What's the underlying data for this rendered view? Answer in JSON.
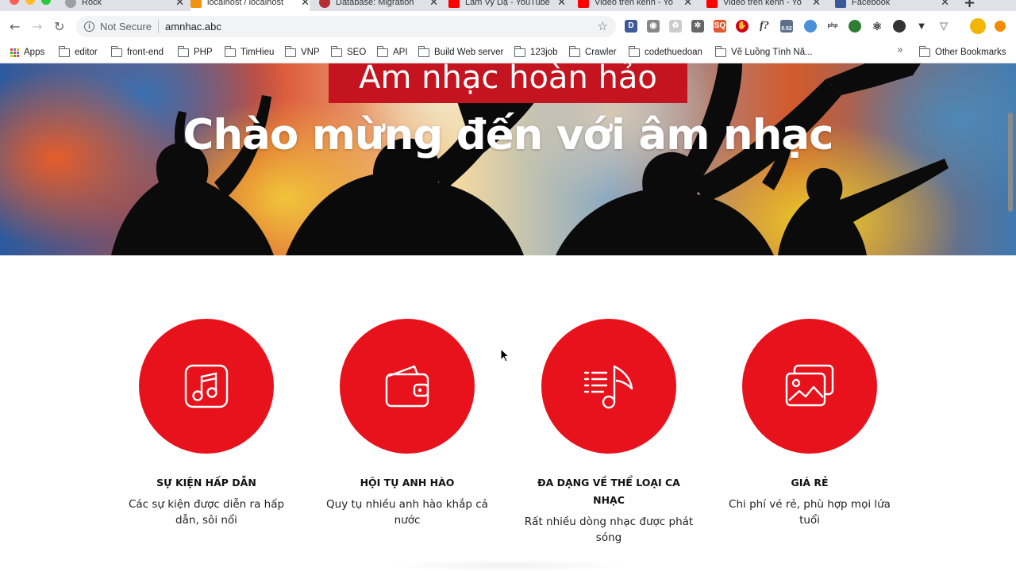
{
  "browser": {
    "tabs": [
      {
        "label": "Rock",
        "color": "#9aa0a6"
      },
      {
        "label": "localhost / localhost",
        "color": "#f29111"
      },
      {
        "label": "Database: Migration",
        "color": "#b52e31"
      },
      {
        "label": "Lam Vy Dạ - YouTube",
        "color": "#ff0000"
      },
      {
        "label": "Video trên kênh - Yo",
        "color": "#ff0000"
      },
      {
        "label": "Video trên kênh - Yo",
        "color": "#ff0000"
      },
      {
        "label": "Facebook",
        "color": "#3b5998"
      }
    ],
    "address": {
      "security_label": "Not Secure",
      "url": "amnhac.abc"
    },
    "extension_badge": "0.52",
    "bookmarks": [
      "Apps",
      "editor",
      "front-end",
      "PHP",
      "TimHieu",
      "VNP",
      "SEO",
      "API",
      "Build Web server",
      "123job",
      "Crawler",
      "codethuedoan",
      "Vẽ Luồng Tính Nă...",
      "Other Bookmarks"
    ]
  },
  "hero": {
    "badge": "Âm nhạc hoàn hảo",
    "title": "Chào mừng đến với âm nhạc"
  },
  "features": [
    {
      "icon": "music-note-icon",
      "title": "SỰ KIỆN HẤP DẪN",
      "description": "Các sự kiện được diễn ra hấp dẫn, sôi nổi"
    },
    {
      "icon": "wallet-icon",
      "title": "HỘI TỤ ANH HÀO",
      "description": "Quy tụ nhiều anh hào khắp cả nước"
    },
    {
      "icon": "playlist-icon",
      "title": "ĐA DẠNG VỀ THỂ LOẠI CA NHẠC",
      "description": "Rất nhiều dòng nhạc được phát sóng"
    },
    {
      "icon": "gallery-icon",
      "title": "GIÁ RẺ",
      "description": "Chi phí vé rẻ, phù hợp mọi lứa tuổi"
    }
  ],
  "colors": {
    "accent_red": "#e8121c",
    "badge_red": "#c3141f"
  }
}
